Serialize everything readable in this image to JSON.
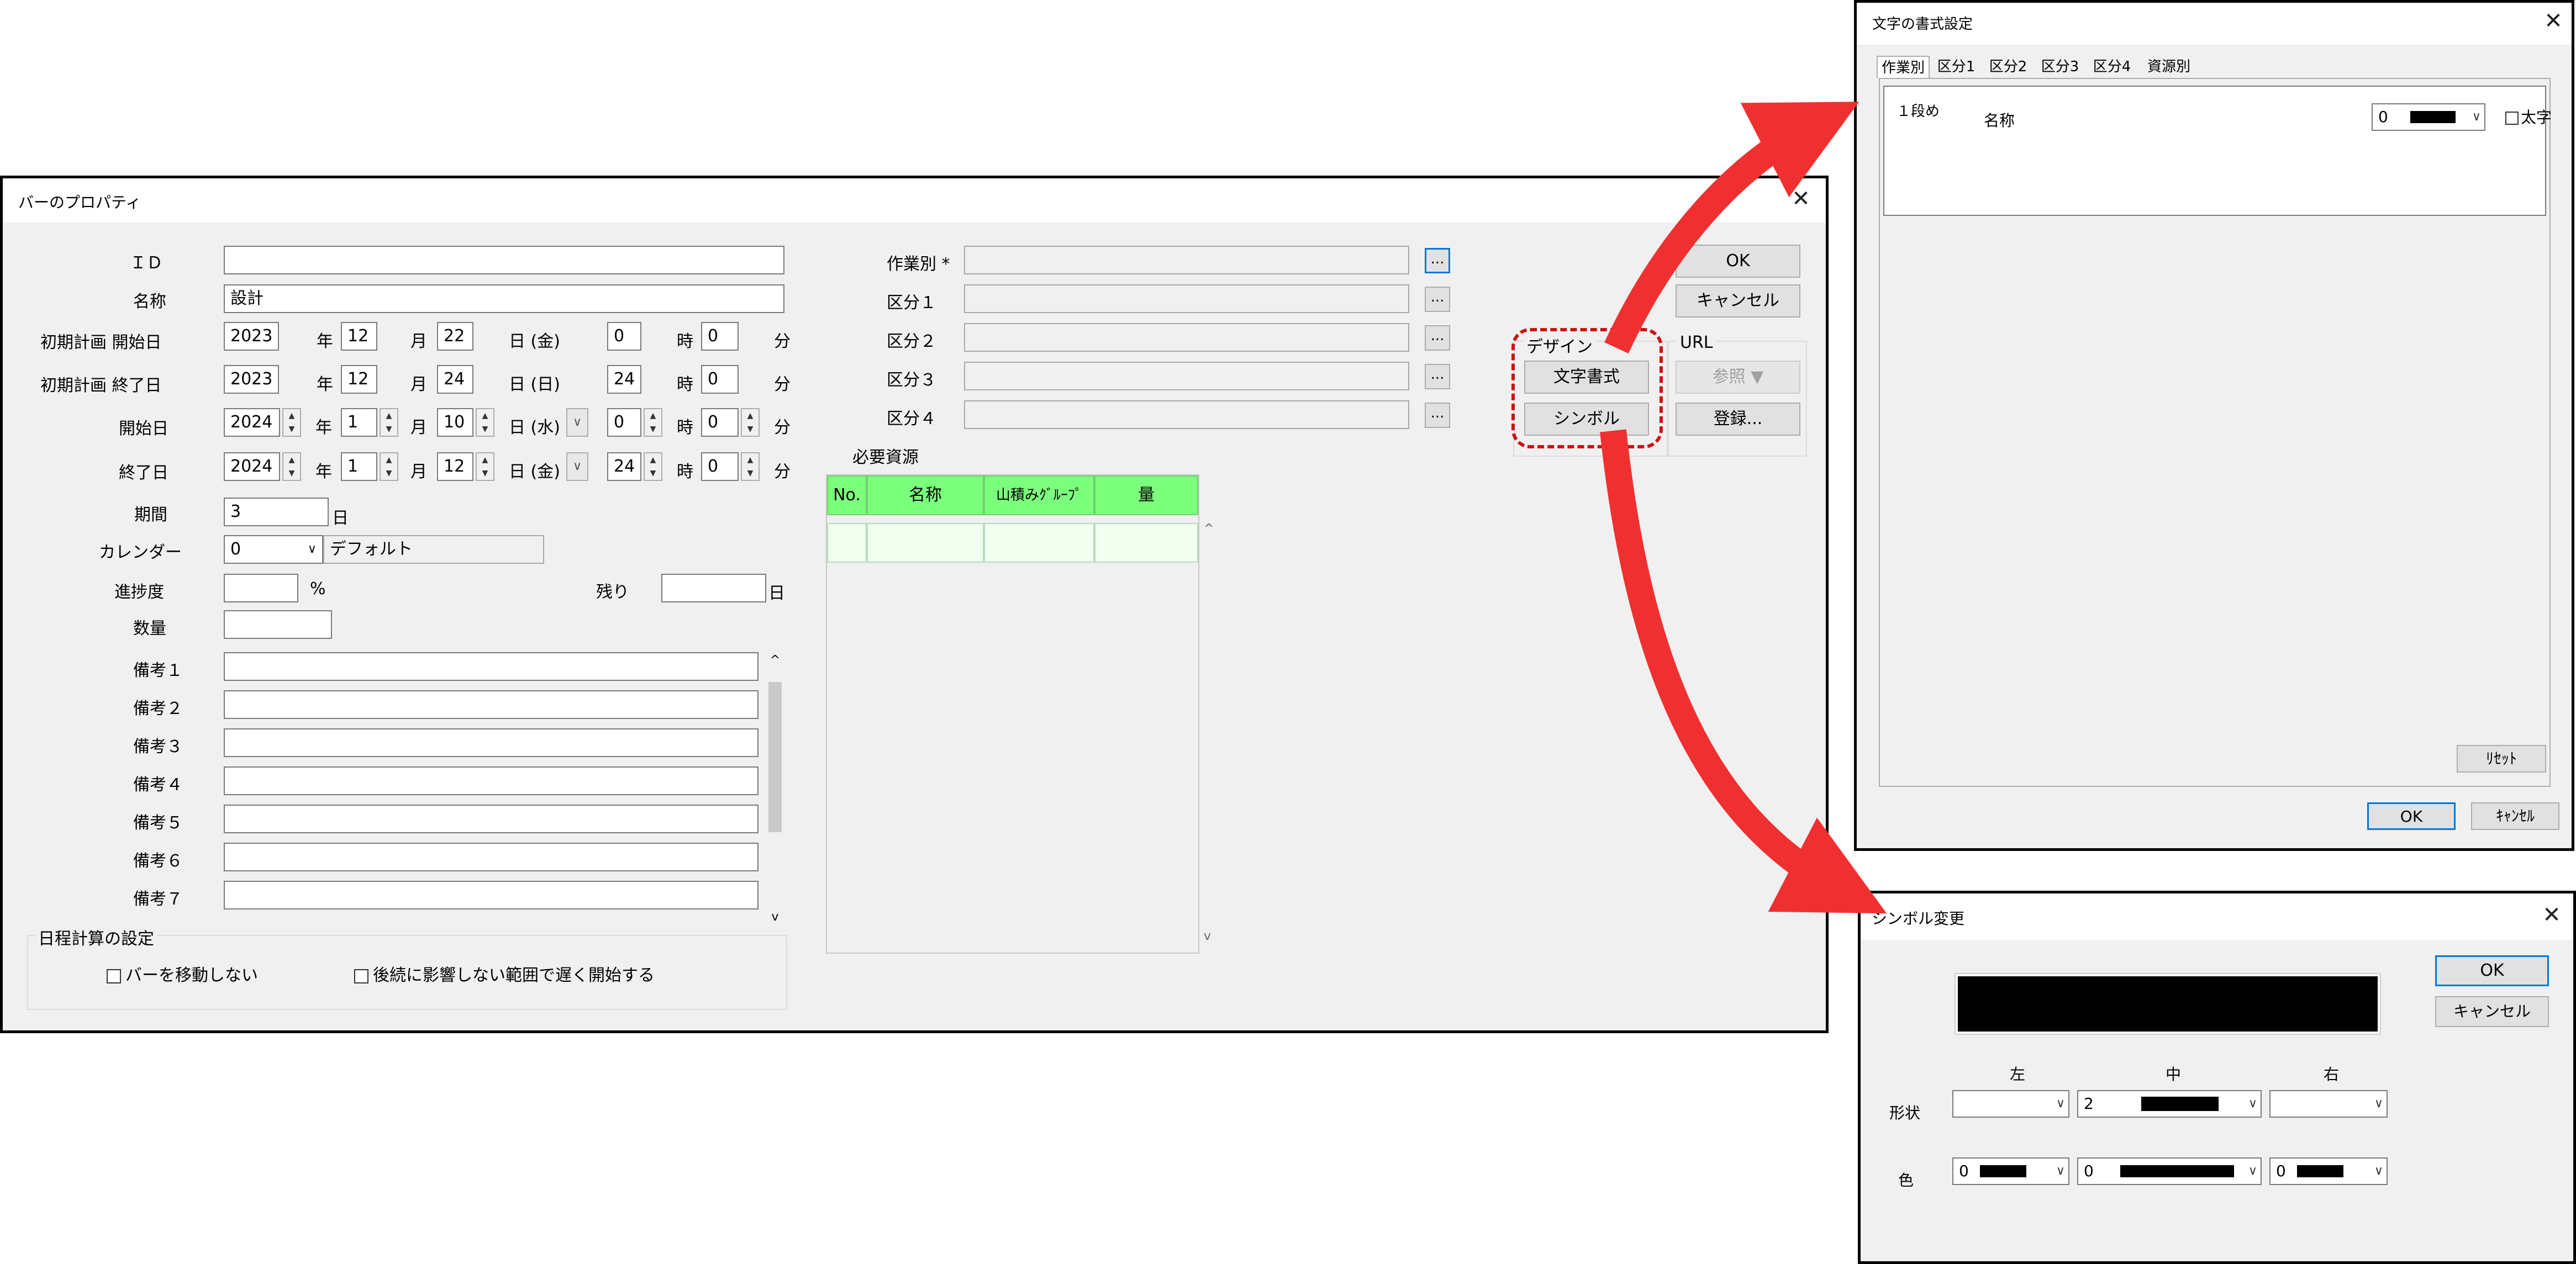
{
  "bar_dialog": {
    "title": "バーのプロパティ",
    "close": "✕",
    "fields": {
      "id_label": "ＩＤ",
      "id_value": "",
      "name_label": "名称",
      "name_value": "設計",
      "plan_start_label": "初期計画 開始日",
      "plan_end_label": "初期計画 終了日",
      "start_label": "開始日",
      "end_label": "終了日",
      "period_label": "期間",
      "period_value": "3",
      "period_unit": "日",
      "calendar_label": "カレンダー",
      "calendar_value": "0",
      "calendar_name": "デフォルト",
      "progress_label": "進捗度",
      "progress_value": "",
      "progress_unit": "%",
      "remaining_label": "残り",
      "remaining_value": "",
      "remaining_unit": "日",
      "quantity_label": "数量",
      "quantity_value": ""
    },
    "date_rows": [
      {
        "year": "2023",
        "month": "12",
        "day": "22",
        "weekday": "日 (金)",
        "hour": "0",
        "minute": "0",
        "spinners": false
      },
      {
        "year": "2023",
        "month": "12",
        "day": "24",
        "weekday": "日 (日)",
        "hour": "24",
        "minute": "0",
        "spinners": false
      },
      {
        "year": "2024",
        "month": "1",
        "day": "10",
        "weekday": "日 (水)",
        "hour": "0",
        "minute": "0",
        "spinners": true
      },
      {
        "year": "2024",
        "month": "1",
        "day": "12",
        "weekday": "日 (金)",
        "hour": "24",
        "minute": "0",
        "spinners": true
      }
    ],
    "units": {
      "year": "年",
      "month": "月",
      "hour": "時",
      "minute": "分"
    },
    "notes": [
      {
        "label": "備考１",
        "value": ""
      },
      {
        "label": "備考２",
        "value": ""
      },
      {
        "label": "備考３",
        "value": ""
      },
      {
        "label": "備考４",
        "value": ""
      },
      {
        "label": "備考５",
        "value": ""
      },
      {
        "label": "備考６",
        "value": ""
      },
      {
        "label": "備考７",
        "value": ""
      }
    ],
    "schedule_group": {
      "title": "日程計算の設定",
      "no_move": "バーを移動しない",
      "late_start": "後続に影響しない範囲で遅く開始する"
    },
    "categories": [
      {
        "label": "作業別 *",
        "value": ""
      },
      {
        "label": "区分１",
        "value": ""
      },
      {
        "label": "区分２",
        "value": ""
      },
      {
        "label": "区分３",
        "value": ""
      },
      {
        "label": "区分４",
        "value": ""
      }
    ],
    "ellipsis": "...",
    "resources": {
      "title": "必要資源",
      "headers": [
        "No.",
        "名称",
        "山積みｸﾞﾙｰﾌﾟ",
        "量"
      ]
    },
    "buttons": {
      "ok": "OK",
      "cancel": "キャンセル"
    },
    "design_group": {
      "title": "デザイン",
      "font_button": "文字書式",
      "symbol_button": "シンボル"
    },
    "url_group": {
      "title": "URL",
      "browse_button": "参照 ▼",
      "register_button": "登録..."
    }
  },
  "font_dialog": {
    "title": "文字の書式設定",
    "close": "✕",
    "tabs": [
      "作業別",
      "区分1",
      "区分2",
      "区分3",
      "区分4",
      "資源別"
    ],
    "row_label": "１段め",
    "field_label": "名称",
    "color_value": "0",
    "bold_label": "太字",
    "reset": "ﾘｾｯﾄ",
    "ok": "OK",
    "cancel": "ｷｬﾝｾﾙ"
  },
  "symbol_dialog": {
    "title": "シンボル変更",
    "close": "✕",
    "ok": "OK",
    "cancel": "キャンセル",
    "col_left": "左",
    "col_center": "中",
    "col_right": "右",
    "shape_label": "形状",
    "color_label": "色",
    "shape_center_value": "2",
    "color_left_value": "0",
    "color_center_value": "0",
    "color_right_value": "0"
  },
  "colors": {
    "highlight": "#cc1111",
    "arrow": "#f03030",
    "grid_header": "#7cff7c",
    "accent": "#0078d7"
  }
}
